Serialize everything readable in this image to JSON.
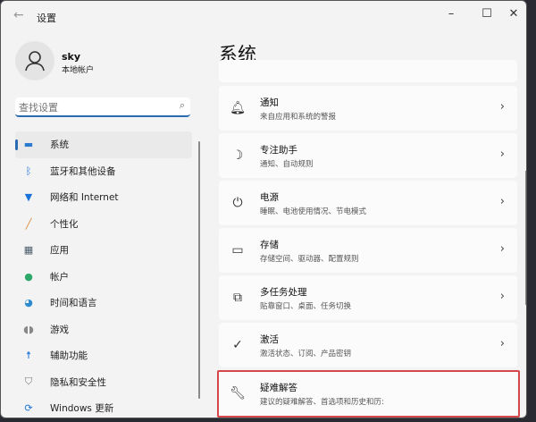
{
  "window": {
    "title": "设置",
    "back_icon": "back-arrow",
    "controls": [
      "minimize",
      "maximize",
      "close"
    ]
  },
  "user": {
    "name": "sky",
    "type": "本地帐户"
  },
  "search": {
    "placeholder": "查找设置"
  },
  "nav": [
    {
      "label": "系统",
      "icon": "system",
      "color": "#2b7bd0",
      "selected": true
    },
    {
      "label": "蓝牙和其他设备",
      "icon": "bluetooth",
      "color": "#1a73d8"
    },
    {
      "label": "网络和 Internet",
      "icon": "wifi",
      "color": "#1a73d8"
    },
    {
      "label": "个性化",
      "icon": "brush",
      "color": "#d98a3a"
    },
    {
      "label": "应用",
      "icon": "apps",
      "color": "#4a5a6a"
    },
    {
      "label": "帐户",
      "icon": "account",
      "color": "#2ea86a"
    },
    {
      "label": "时间和语言",
      "icon": "globe-clock",
      "color": "#2b8ad0"
    },
    {
      "label": "游戏",
      "icon": "gamepad",
      "color": "#888"
    },
    {
      "label": "辅助功能",
      "icon": "accessibility",
      "color": "#1a73d8"
    },
    {
      "label": "隐私和安全性",
      "icon": "shield",
      "color": "#777"
    },
    {
      "label": "Windows 更新",
      "icon": "update",
      "color": "#1a73d8"
    }
  ],
  "main": {
    "heading": "系统",
    "cards": [
      {
        "title": "通知",
        "subtitle": "来自应用和系统的警报",
        "icon": "bell"
      },
      {
        "title": "专注助手",
        "subtitle": "通知、自动规则",
        "icon": "moon"
      },
      {
        "title": "电源",
        "subtitle": "睡眠、电池使用情况、节电模式",
        "icon": "power"
      },
      {
        "title": "存储",
        "subtitle": "存储空间、驱动器、配置规则",
        "icon": "storage"
      },
      {
        "title": "多任务处理",
        "subtitle": "贴靠窗口、桌面、任务切换",
        "icon": "multitask"
      },
      {
        "title": "激活",
        "subtitle": "激活状态、订阅、产品密钥",
        "icon": "check-circle"
      },
      {
        "title": "疑难解答",
        "subtitle": "建议的疑难解答、首选项和历史和历:",
        "icon": "wrench",
        "highlighted": true
      }
    ]
  },
  "highlight_color": "#d5474a"
}
